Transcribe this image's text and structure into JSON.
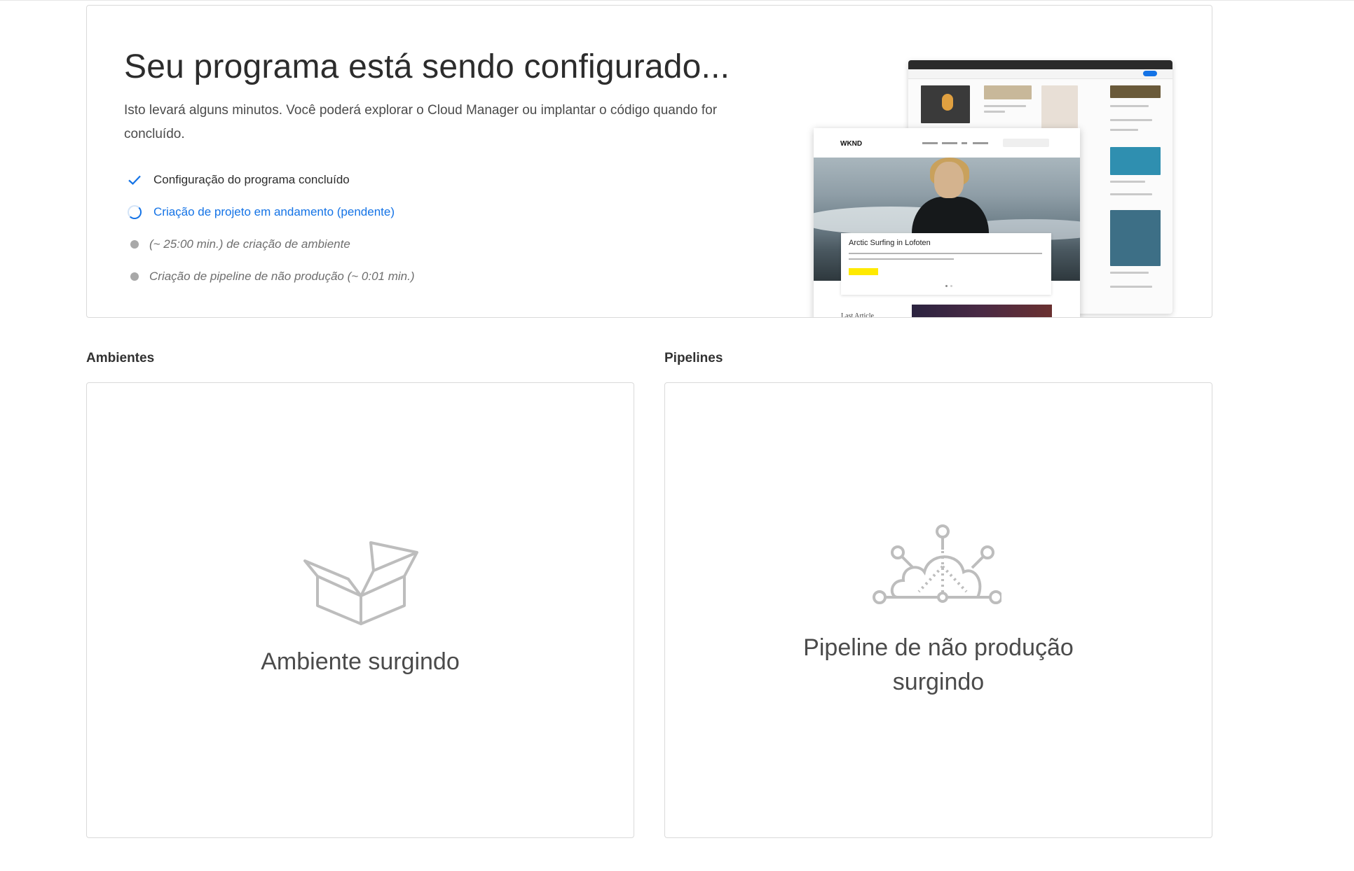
{
  "setup": {
    "title": "Seu programa está sendo configurado...",
    "description": "Isto levará alguns minutos. Você poderá explorar o Cloud Manager ou implantar o código quando for concluído.",
    "steps": [
      {
        "status": "done",
        "icon": "checkmark-icon",
        "label": "Configuração do programa concluído"
      },
      {
        "status": "active",
        "icon": "spinner-icon",
        "label": "Criação de projeto em andamento (pendente)"
      },
      {
        "status": "pending",
        "icon": "dot-icon",
        "label": "(~ 25:00 min.) de criação de ambiente"
      },
      {
        "status": "pending",
        "icon": "dot-icon",
        "label": "Criação de pipeline de não produção (~ 0:01 min.)"
      }
    ],
    "preview": {
      "logo": "WKND",
      "hero_title": "Arctic Surfing in Lofoten",
      "last_article": "Last Article"
    }
  },
  "environments": {
    "heading": "Ambientes",
    "icon": "box-icon",
    "empty_text": "Ambiente surgindo"
  },
  "pipelines": {
    "heading": "Pipelines",
    "icon": "cloud-pipeline-icon",
    "empty_text_line1": "Pipeline de não produção",
    "empty_text_line2": "surgindo"
  },
  "colors": {
    "accent_blue": "#1473e6",
    "pending_dot": "#a8a8a8",
    "border": "#dadada"
  }
}
